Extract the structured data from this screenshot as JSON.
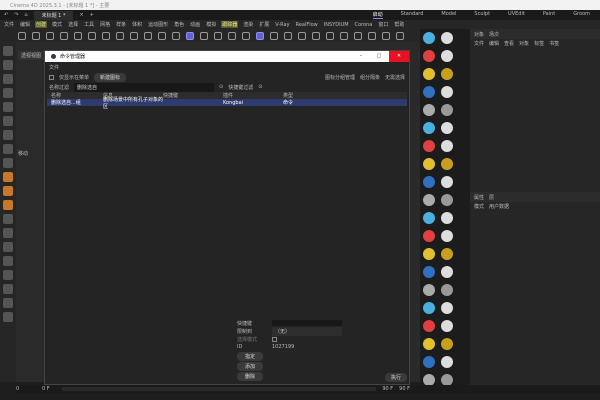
{
  "window": {
    "title": "Cinema 4D 2025.3.1 - [未标题 1 *] - 主要"
  },
  "tabs": {
    "doc": "未标题 1 *",
    "close": "×",
    "add": "+"
  },
  "layouts": [
    "启动",
    "Standard",
    "Model",
    "Sculpt",
    "UVEdit",
    "Paint",
    "Groom"
  ],
  "menu": [
    "文件",
    "编辑",
    "创建",
    "模式",
    "选择",
    "工具",
    "网格",
    "样条",
    "体积",
    "运动图形",
    "角色",
    "动画",
    "模拟",
    "跟踪器",
    "渲染",
    "扩展",
    "V-Ray",
    "RealFlow",
    "INSYDIUM",
    "Corona",
    "窗口",
    "帮助"
  ],
  "viewport": {
    "label": "透视视图",
    "move_label": "移动"
  },
  "dialog": {
    "title": "命令管理器",
    "menu": "文件",
    "only_menu_label": "仅显示在菜单",
    "new_icon_button": "新建图标",
    "right_buttons": [
      "图标分组管理",
      "组分隔条",
      "无需选择"
    ],
    "name_filter_label": "名称过滤",
    "name_filter_value": "删除选自",
    "shortcut_filter_label": "快捷键过滤",
    "columns": [
      "名称",
      "信息",
      "快捷键",
      "插件",
      "类型"
    ],
    "rows": [
      {
        "name": "删除选自...组",
        "info": "删除场景中所有孔子对象的区",
        "shortcut": "",
        "plugin": "Kongbai",
        "type": "命令"
      }
    ],
    "shortcut_label": "快捷键",
    "restrict_label": "限制到",
    "restrict_value": "（无）",
    "select_mode_label": "选择模式",
    "id_label": "ID",
    "id_value": "1027199",
    "assign_button": "指定",
    "add_button": "添加",
    "delete_button": "删除",
    "execute_button": "执行"
  },
  "object_panel": {
    "tabs": [
      "对象",
      "场次"
    ],
    "menu": [
      "文件",
      "编辑",
      "查看",
      "对象",
      "标签",
      "书签"
    ]
  },
  "attr_panel": {
    "tabs": [
      "属性",
      "层"
    ],
    "menu": [
      "模式",
      "用户数据"
    ]
  },
  "timeline": {
    "start": "0 F",
    "end": "90 F",
    "end2": "90 F",
    "cur": "0"
  }
}
